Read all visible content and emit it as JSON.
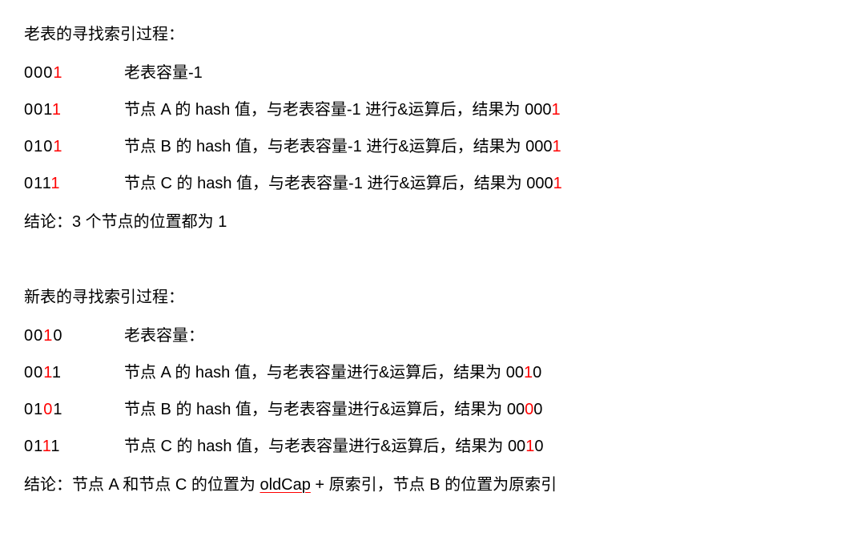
{
  "section1": {
    "title": "老表的寻找索引过程：",
    "rows": [
      {
        "binary_pre": "000",
        "binary_red": "1",
        "binary_post": "",
        "desc_pre": "老表容量-1",
        "result_pre": "",
        "result_red": "",
        "result_post": ""
      },
      {
        "binary_pre": "001",
        "binary_red": "1",
        "binary_post": "",
        "desc_pre": "节点 A 的 hash 值，与老表容量-1 进行&运算后，结果为 ",
        "result_pre": "000",
        "result_red": "1",
        "result_post": ""
      },
      {
        "binary_pre": "010",
        "binary_red": "1",
        "binary_post": "",
        "desc_pre": "节点 B 的 hash 值，与老表容量-1 进行&运算后，结果为 ",
        "result_pre": "000",
        "result_red": "1",
        "result_post": ""
      },
      {
        "binary_pre": "011",
        "binary_red": "1",
        "binary_post": "",
        "desc_pre": "节点 C 的 hash 值，与老表容量-1 进行&运算后，结果为 ",
        "result_pre": "000",
        "result_red": "1",
        "result_post": ""
      }
    ],
    "conclusion": "结论：3 个节点的位置都为 1"
  },
  "section2": {
    "title": "新表的寻找索引过程：",
    "rows": [
      {
        "binary_pre": "00",
        "binary_red": "1",
        "binary_post": "0",
        "desc_pre": "老表容量：",
        "result_pre": "",
        "result_red": "",
        "result_post": ""
      },
      {
        "binary_pre": "00",
        "binary_red": "1",
        "binary_post": "1",
        "desc_pre": "节点 A 的 hash 值，与老表容量进行&运算后，结果为 ",
        "result_pre": "00",
        "result_red": "1",
        "result_post": "0"
      },
      {
        "binary_pre": "01",
        "binary_red": "0",
        "binary_post": "1",
        "desc_pre": "节点 B 的 hash 值，与老表容量进行&运算后，结果为 ",
        "result_pre": "00",
        "result_red": "0",
        "result_post": "0"
      },
      {
        "binary_pre": "01",
        "binary_red": "1",
        "binary_post": "1",
        "desc_pre": "节点 C 的 hash 值，与老表容量进行&运算后，结果为 ",
        "result_pre": "00",
        "result_red": "1",
        "result_post": "0"
      }
    ],
    "conclusion_pre": "结论：节点 A 和节点 C 的位置为 ",
    "conclusion_oldcap": "oldCap",
    "conclusion_plus": " +  原索引，节点 B 的位置为原索引"
  }
}
